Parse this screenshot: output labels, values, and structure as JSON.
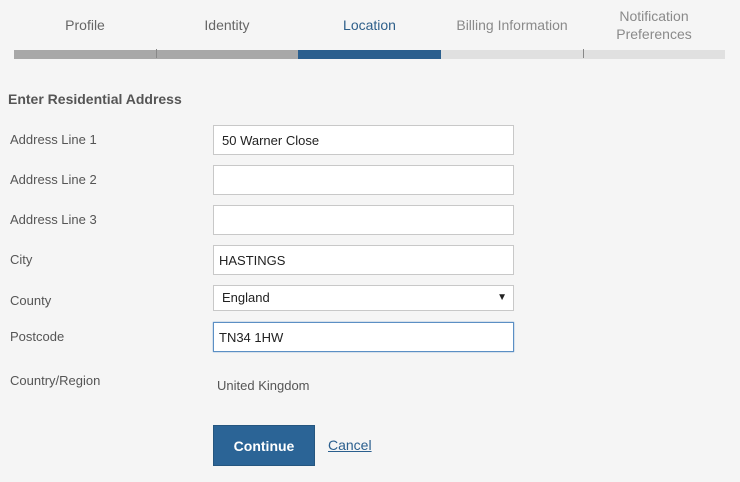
{
  "steps": [
    {
      "label": "Profile",
      "state": "done"
    },
    {
      "label": "Identity",
      "state": "done"
    },
    {
      "label": "Location",
      "state": "active"
    },
    {
      "label": "Billing Information",
      "state": "pending"
    },
    {
      "label": "Notification Preferences",
      "state": "pending"
    }
  ],
  "form": {
    "title": "Enter Residential Address",
    "address_line_1": {
      "label": "Address Line 1",
      "value": "50 Warner Close"
    },
    "address_line_2": {
      "label": "Address Line 2",
      "value": ""
    },
    "address_line_3": {
      "label": "Address Line 3",
      "value": ""
    },
    "city": {
      "label": "City",
      "value": "HASTINGS"
    },
    "county": {
      "label": "County",
      "value": "England"
    },
    "postcode": {
      "label": "Postcode",
      "value": "TN34 1HW"
    },
    "country": {
      "label": "Country/Region",
      "value": "United Kingdom"
    }
  },
  "actions": {
    "continue_label": "Continue",
    "cancel_label": "Cancel"
  },
  "colors": {
    "accent": "#2b5f8e",
    "button": "#2b6496",
    "step_done": "#a8a8a8",
    "step_pending": "#e0e0e0"
  }
}
